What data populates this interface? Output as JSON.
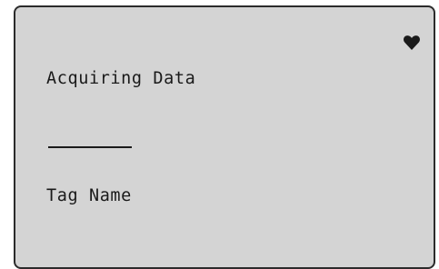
{
  "display": {
    "status_text": "Acquiring Data",
    "value_text": "",
    "tag_label": "Tag Name"
  },
  "indicators": {
    "heartbeat_icon": "heart-icon",
    "heartbeat_color": "#1a1a1a"
  },
  "colors": {
    "screen_bg": "#d4d4d4",
    "text": "#1a1a1a",
    "border": "#2b2b2b"
  }
}
